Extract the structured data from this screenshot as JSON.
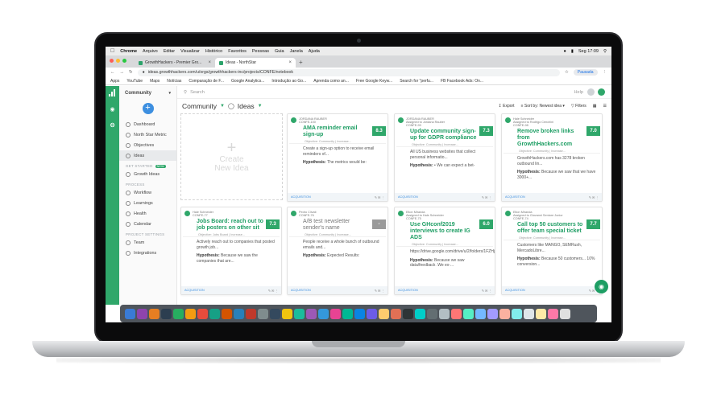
{
  "menubar": {
    "apple": "",
    "items": [
      "Chrome",
      "Arquivo",
      "Editar",
      "Visualizar",
      "Histórico",
      "Favoritos",
      "Pessoas",
      "Guia",
      "Janela",
      "Ajuda"
    ],
    "clock": "Seg 17:09"
  },
  "browser": {
    "tabs": [
      {
        "label": "GrowthHackers - Premier Gro..."
      },
      {
        "label": "Ideas - NorthStar"
      }
    ],
    "url": "ideas.growthhackers.com/u/orgs/growthhackers-inc/projects/CONFE/notebook",
    "profile_label": "Pausada",
    "bookmarks": [
      "Apps",
      "YouTube",
      "Maps",
      "Notícias",
      "Comparação de F...",
      "Google Analytics...",
      "Introdução ao Go...",
      "Aprenda como an...",
      "Free Google Keyw...",
      "Search for \"perfu...",
      "FB  Facebook Ads: On..."
    ]
  },
  "sidebar": {
    "project": "Community",
    "items": [
      {
        "label": "Dashboard"
      },
      {
        "label": "North Star Metric"
      },
      {
        "label": "Objectives"
      },
      {
        "label": "Ideas"
      }
    ],
    "sections": {
      "get_started": "GET STARTED",
      "new_badge": "NEW",
      "process": "PROCESS",
      "project_settings": "PROJECT SETTINGS"
    },
    "get_started_items": [
      {
        "label": "Growth Ideas"
      }
    ],
    "process_items": [
      {
        "label": "Workflow"
      },
      {
        "label": "Learnings"
      },
      {
        "label": "Health"
      },
      {
        "label": "Calendar"
      }
    ],
    "settings_items": [
      {
        "label": "Team"
      },
      {
        "label": "Integrations"
      }
    ]
  },
  "topbar": {
    "search_placeholder": "Search",
    "help": "Help"
  },
  "crumbs": {
    "project": "Community",
    "section": "Ideas",
    "export": "Export",
    "sort": "Sort by: Newest idea",
    "filters": "Filters"
  },
  "create": {
    "label_line1": "Create",
    "label_line2": "New Idea"
  },
  "cards": [
    {
      "author": "JORDANA RAUBER",
      "id": "CONFE-100",
      "title": "AMA reminder email sign-up",
      "score": "8.3",
      "objective": "Objective: Community | Increase...",
      "desc": "Create a sign-up option to receive email reminders of...",
      "hyp_label": "Hypothesis:",
      "hyp": "The metrics would be:",
      "tag": "ACQUISITION"
    },
    {
      "author": "JORDANA RAUBER",
      "assigned": "Assigned to Jordana Rauber",
      "id": "CONFE-99",
      "title": "Update community sign-up for GDPR compliance",
      "score": "7.3",
      "objective": "Objective: Community | Increase...",
      "desc": "All US business websites that collect personal informatio...",
      "hyp_label": "Hypothesis:",
      "hyp": "• We can expect a bet-",
      "tag": "ACQUISITION"
    },
    {
      "author": "Hale Schneider",
      "assigned": "Assigned to Rodrigo Cenchini",
      "id": "CONFE-98",
      "title": "Remove broken links from GrowthHackers.com",
      "score": "7.0",
      "objective": "Objective: Community | Increase...",
      "desc": "GrowthHackers.com has 3278 broken outbound lin...",
      "hyp_label": "Hypothesis:",
      "hyp": "Because we saw that we have 3000+...",
      "tag": "ACQUISITION"
    },
    {
      "author": "Hale Schneider",
      "id": "CONFE-77",
      "title": "Jobs Board: reach out to job posters on other sit",
      "score": "7.3",
      "objective": "Objective: Jobs Board | Increase...",
      "desc": "Actively reach out to companies that posted growth job...",
      "hyp_label": "Hypothesis:",
      "hyp": "Because we saw the companies that are...",
      "tag": "ACQUISITION"
    },
    {
      "author": "Pedro Clivati",
      "id": "CONFE-76",
      "title": "A/B test newsletter sender's name",
      "score": "-",
      "objective": "Objective: Community | Increase...",
      "desc": "People receive a whole bunch of outbound emails and...",
      "hyp_label": "Hypothesis:",
      "hyp": "Expected Results:",
      "tag": "ACQUISITION"
    },
    {
      "author": "Elton Miranda",
      "assigned": "Assigned to Hale Schneider",
      "id": "CONFE-75",
      "title": "Use GHconf2019 interviews to create IG ADS",
      "score": "6.0",
      "objective": "Objective: Community | Increase...",
      "desc": "https://drive.google.com/drive/u/2/folders/1FZHjxT7xyP...",
      "hyp_label": "Hypothesis:",
      "hyp": "Because we saw data/feedback .We ex-...",
      "tag": "ACQUISITION"
    },
    {
      "author": "Elton Miranda",
      "assigned": "Assigned to Giovanni Sentore Junior",
      "id": "CONFE-74",
      "title": "Call top 50 customers to offer team special ticket",
      "score": "7.7",
      "objective": "Objective: Community | Increase...",
      "desc": "Customers like MANGO, SEMRush, MercadoLibre...",
      "hyp_label": "Hypothesis:",
      "hyp": "Because 50 customers... 10% conversion...",
      "tag": "ACQUISITION"
    }
  ],
  "colors": {
    "brand_green": "#2fa76a",
    "title_green": "#1e9e64",
    "accent_blue": "#3d8fe0"
  }
}
